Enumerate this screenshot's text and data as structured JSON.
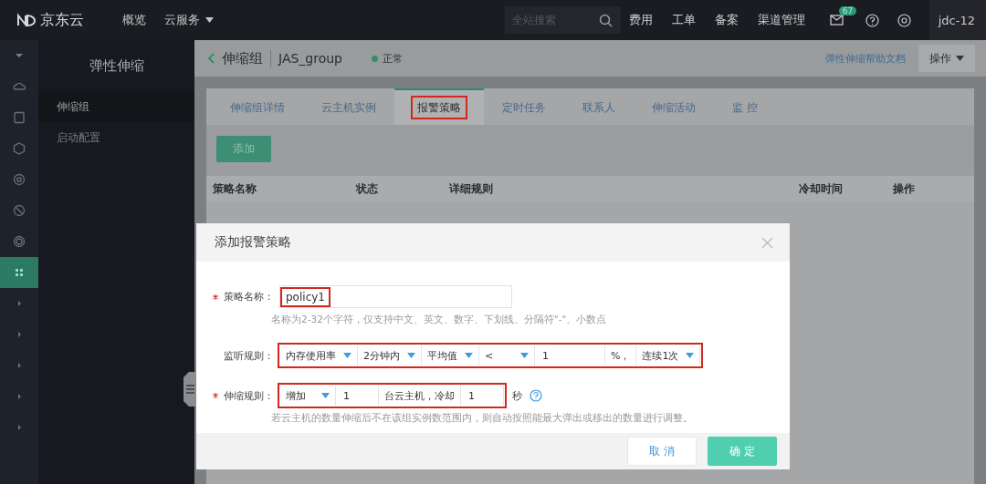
{
  "topbar": {
    "brand": "京东云",
    "nav": [
      {
        "label": "概览",
        "dropdown": false
      },
      {
        "label": "云服务",
        "dropdown": true
      }
    ],
    "search": {
      "placeholder": "全站搜索"
    },
    "links": [
      "费用",
      "工单",
      "备案",
      "渠道管理"
    ],
    "mail_badge": "67",
    "user": "jdc-12"
  },
  "rail": [
    {
      "kind": "caret",
      "selected": false
    },
    {
      "kind": "cloud",
      "selected": false
    },
    {
      "kind": "disk",
      "selected": false
    },
    {
      "kind": "cube",
      "selected": false
    },
    {
      "kind": "gear",
      "selected": false
    },
    {
      "kind": "ban",
      "selected": false
    },
    {
      "kind": "ring",
      "selected": false
    },
    {
      "kind": "grid",
      "selected": true
    },
    {
      "kind": "chevron",
      "selected": false
    },
    {
      "kind": "chevron",
      "selected": false
    },
    {
      "kind": "chevron",
      "selected": false
    },
    {
      "kind": "chevron",
      "selected": false
    },
    {
      "kind": "chevron",
      "selected": false
    }
  ],
  "sidebar": {
    "title": "弹性伸缩",
    "items": [
      {
        "label": "伸缩组",
        "selected": true
      },
      {
        "label": "启动配置",
        "selected": false
      }
    ]
  },
  "header": {
    "section": "伸缩组",
    "name": "JAS_group",
    "status": "正常",
    "help_link": "弹性伸缩帮助文档",
    "action_button": "操作"
  },
  "tabs": [
    {
      "label": "伸缩组详情",
      "selected": false,
      "highlighted": false
    },
    {
      "label": "云主机实例",
      "selected": false,
      "highlighted": false
    },
    {
      "label": "报警策略",
      "selected": true,
      "highlighted": true
    },
    {
      "label": "定时任务",
      "selected": false,
      "highlighted": false
    },
    {
      "label": "联系人",
      "selected": false,
      "highlighted": false
    },
    {
      "label": "伸缩活动",
      "selected": false,
      "highlighted": false
    },
    {
      "label": "监 控",
      "selected": false,
      "highlighted": false
    }
  ],
  "add_button": "添加",
  "table": {
    "columns": [
      "策略名称",
      "状态",
      "详细规则",
      "冷却时间",
      "操作"
    ]
  },
  "dialog": {
    "title": "添加报警策略",
    "name_field": {
      "label": "策略名称：",
      "required": true,
      "value": "policy1",
      "highlighted": true,
      "hint": "名称为2-32个字符，仅支持中文、英文、数字、下划线、分隔符\"-\"、小数点"
    },
    "monitor_rule": {
      "label": "监听规则：",
      "highlighted": true,
      "controls": [
        {
          "kind": "select",
          "value": "内存使用率"
        },
        {
          "kind": "select",
          "value": "2分钟内"
        },
        {
          "kind": "select",
          "value": "平均值"
        },
        {
          "kind": "select",
          "value": "<"
        },
        {
          "kind": "input",
          "value": "1"
        },
        {
          "kind": "text",
          "value": "%，"
        },
        {
          "kind": "select",
          "value": "连续1次"
        }
      ]
    },
    "scale_rule": {
      "label": "伸缩规则：",
      "required": true,
      "highlighted": true,
      "controls": [
        {
          "kind": "select",
          "value": "增加"
        },
        {
          "kind": "input",
          "value": "1"
        },
        {
          "kind": "text",
          "value": "台云主机，冷却"
        },
        {
          "kind": "input",
          "value": "1"
        }
      ],
      "suffix": "秒",
      "hint": "若云主机的数量伸缩后不在该组实例数范围内，则自动按照能最大弹出或移出的数量进行调整。"
    },
    "buttons": [
      {
        "kind": "cancel",
        "label": "取 消"
      },
      {
        "kind": "primary",
        "label": "确 定"
      }
    ]
  }
}
